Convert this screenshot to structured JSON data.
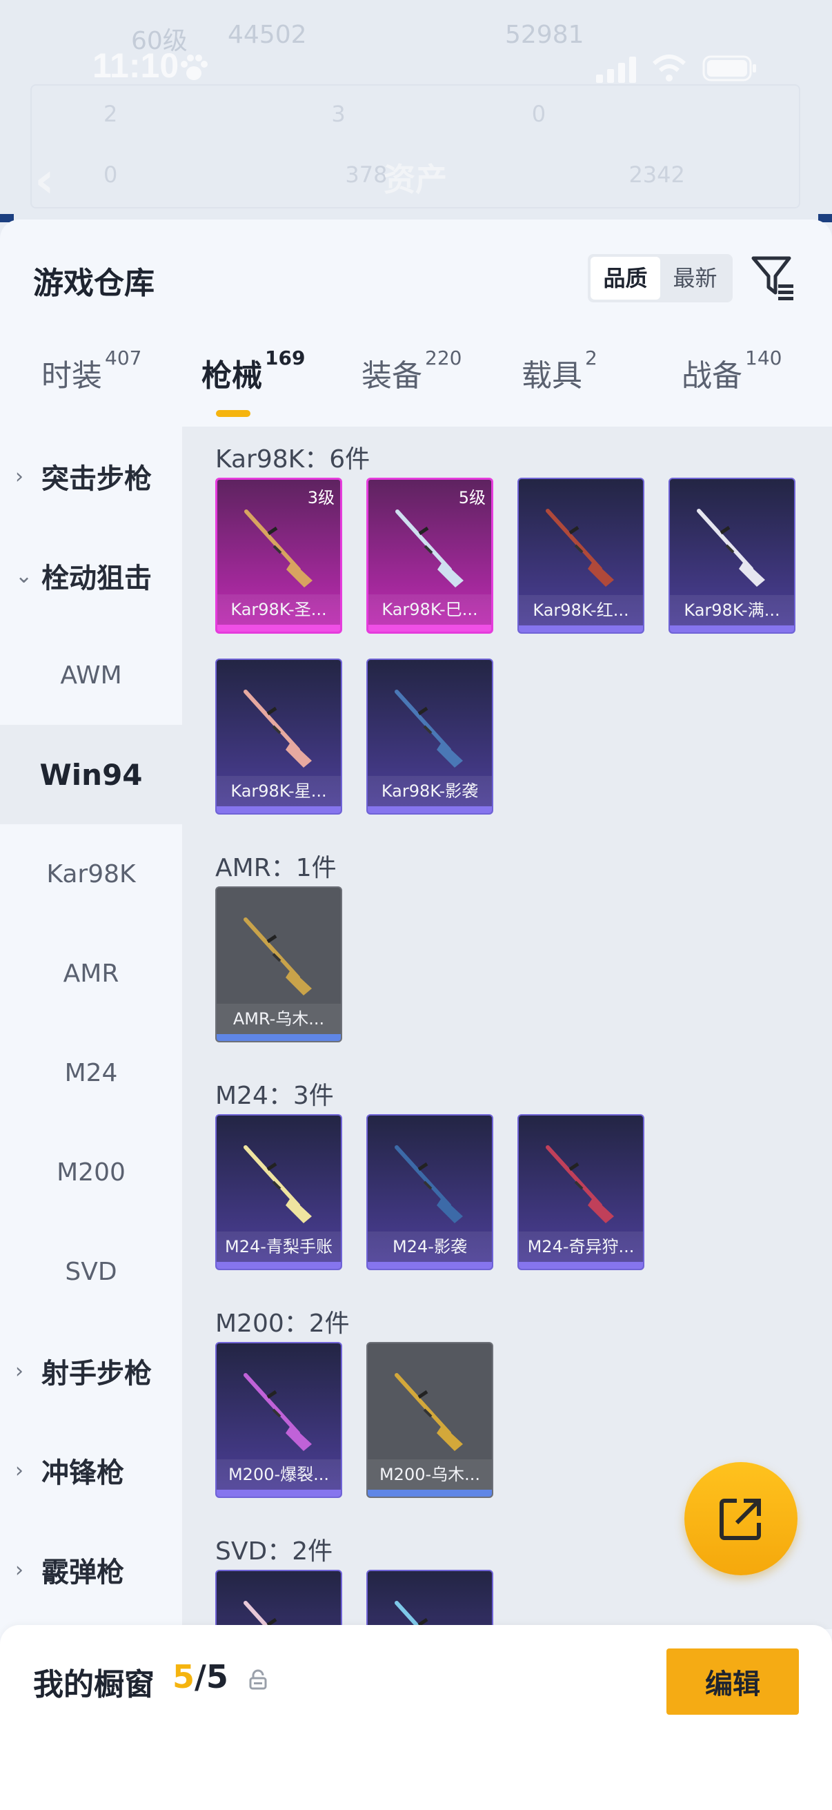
{
  "status_bar": {
    "time": "11:10"
  },
  "background_header": {
    "title": "资产",
    "faded_level": "60级",
    "faded_values": [
      "44502",
      "52981"
    ],
    "faded_stats_row1": [
      "2",
      "3",
      "0"
    ],
    "faded_stats_row2": [
      "0",
      "378",
      "2342"
    ]
  },
  "sheet": {
    "title": "游戏仓库",
    "sort": {
      "options": [
        "品质",
        "最新"
      ],
      "selected": "品质"
    },
    "filter_icon": "filter-icon"
  },
  "tabs": [
    {
      "label": "时装",
      "count": "407",
      "active": false
    },
    {
      "label": "枪械",
      "count": "169",
      "active": true
    },
    {
      "label": "装备",
      "count": "220",
      "active": false
    },
    {
      "label": "载具",
      "count": "2",
      "active": false
    },
    {
      "label": "战备",
      "count": "140",
      "active": false
    }
  ],
  "side_nav": [
    {
      "label": "突击步枪",
      "type": "category",
      "expanded": false
    },
    {
      "label": "栓动狙击",
      "type": "category",
      "expanded": true
    },
    {
      "label": "AWM",
      "type": "sub"
    },
    {
      "label": "Win94",
      "type": "sub",
      "selected": true
    },
    {
      "label": "Kar98K",
      "type": "sub"
    },
    {
      "label": "AMR",
      "type": "sub"
    },
    {
      "label": "M24",
      "type": "sub"
    },
    {
      "label": "M200",
      "type": "sub"
    },
    {
      "label": "SVD",
      "type": "sub"
    },
    {
      "label": "射手步枪",
      "type": "category",
      "expanded": false
    },
    {
      "label": "冲锋枪",
      "type": "category",
      "expanded": false
    },
    {
      "label": "霰弹枪",
      "type": "category",
      "expanded": false
    }
  ],
  "sections": [
    {
      "title": "Kar98K：6件",
      "items": [
        {
          "name": "Kar98K-圣...",
          "rarity": "pink",
          "level": "3级",
          "gun_color": "#d8a460"
        },
        {
          "name": "Kar98K-巳...",
          "rarity": "pink",
          "level": "5级",
          "gun_color": "#cfe0f0"
        },
        {
          "name": "Kar98K-红...",
          "rarity": "purple",
          "level": "",
          "gun_color": "#b0493a"
        },
        {
          "name": "Kar98K-满...",
          "rarity": "purple",
          "level": "",
          "gun_color": "#e6e6f0"
        },
        {
          "name": "Kar98K-星...",
          "rarity": "purple",
          "level": "",
          "gun_color": "#e7a9a0"
        },
        {
          "name": "Kar98K-影袭",
          "rarity": "purple",
          "level": "",
          "gun_color": "#4a78b6"
        }
      ]
    },
    {
      "title": "AMR：1件",
      "items": [
        {
          "name": "AMR-乌木...",
          "rarity": "gray",
          "level": "",
          "gun_color": "#c9a34a"
        }
      ]
    },
    {
      "title": "M24：3件",
      "items": [
        {
          "name": "M24-青梨手账",
          "rarity": "purple",
          "level": "",
          "gun_color": "#efe4a0"
        },
        {
          "name": "M24-影袭",
          "rarity": "purple",
          "level": "",
          "gun_color": "#3c6aa8"
        },
        {
          "name": "M24-奇异狩...",
          "rarity": "purple",
          "level": "",
          "gun_color": "#c0405a"
        }
      ]
    },
    {
      "title": "M200：2件",
      "items": [
        {
          "name": "M200-爆裂...",
          "rarity": "purple",
          "level": "",
          "gun_color": "#c062d8"
        },
        {
          "name": "M200-乌木...",
          "rarity": "gray",
          "level": "",
          "gun_color": "#d3a83a"
        }
      ]
    },
    {
      "title": "SVD：2件",
      "items": [
        {
          "name": "",
          "rarity": "purple",
          "level": "",
          "gun_color": "#e8c8d8"
        },
        {
          "name": "",
          "rarity": "purple",
          "level": "",
          "gun_color": "#7ec8e8"
        }
      ]
    }
  ],
  "fab_icon": "share-icon",
  "bottom_bar": {
    "label": "我的橱窗",
    "current": "5",
    "total": "5",
    "lock_icon": "lock-icon",
    "edit_label": "编辑"
  },
  "colors": {
    "accent": "#f5b40f",
    "pink_rarity": "#e53cdc",
    "purple_rarity": "#6f63d6"
  }
}
